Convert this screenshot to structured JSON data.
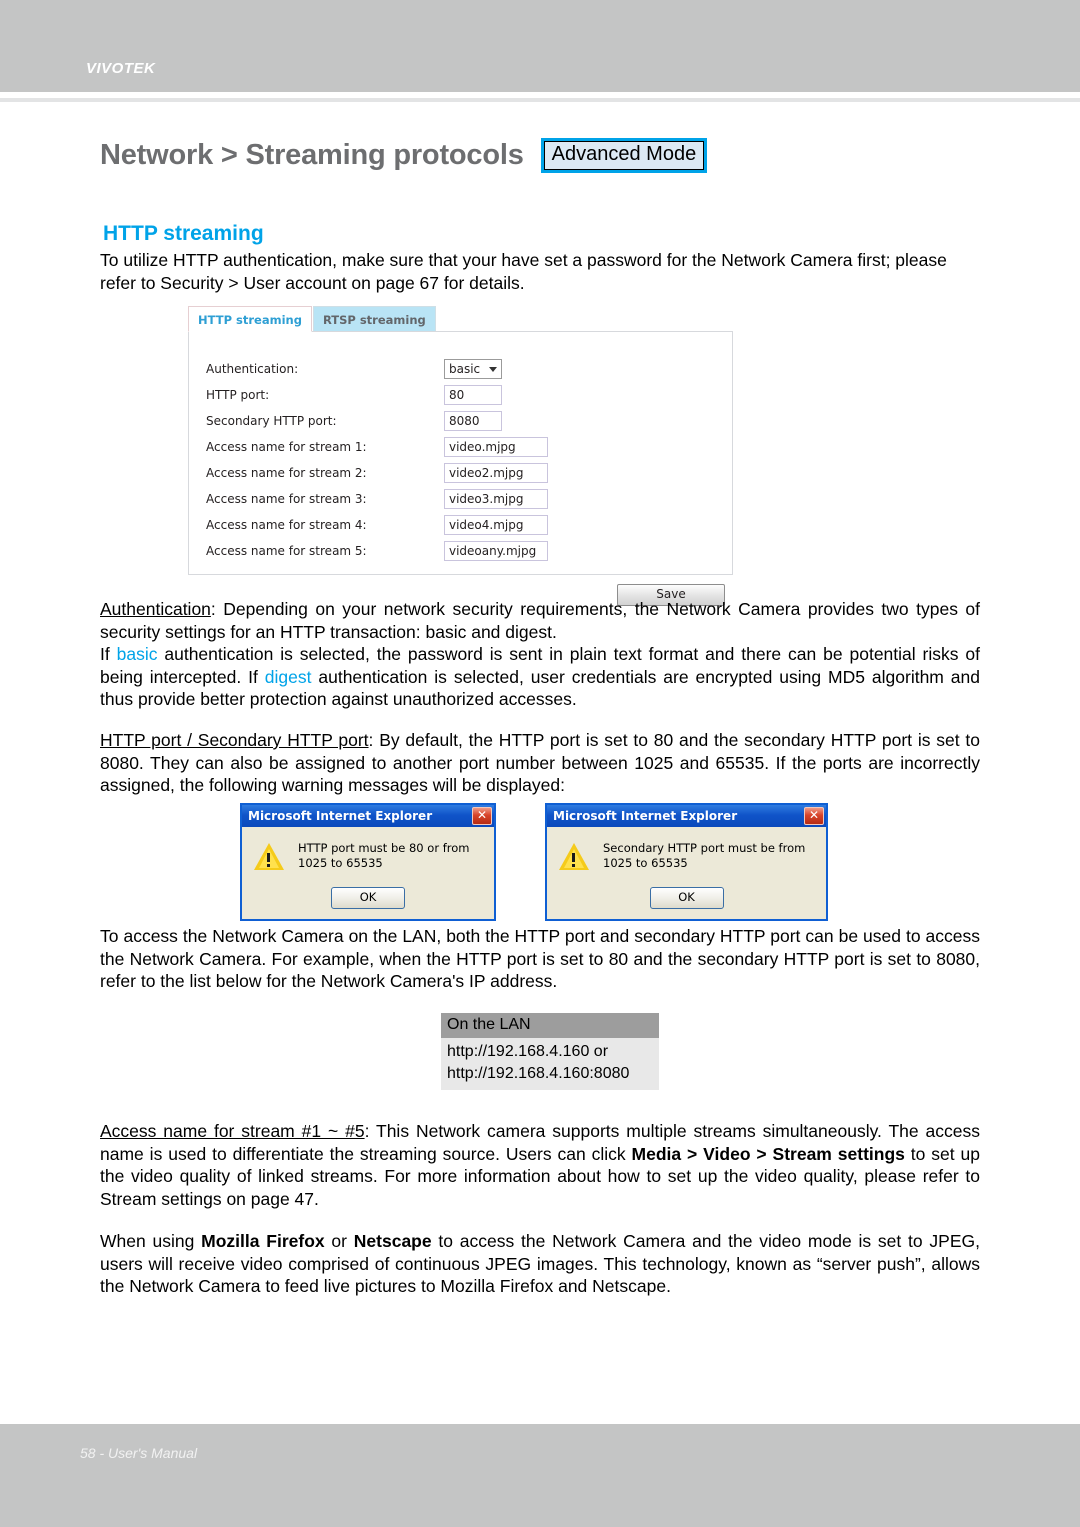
{
  "header": {
    "brand": "VIVOTEK"
  },
  "footer": {
    "text": "58 - User's Manual"
  },
  "title": {
    "heading": "Network > Streaming protocols",
    "badge": "Advanced Mode"
  },
  "section": {
    "title": "HTTP streaming",
    "intro": "To utilize HTTP authentication, make sure that your have set a password for the Network Camera first; please refer to Security > User account on page 67 for details."
  },
  "camera_ui": {
    "tabs": [
      {
        "label": "HTTP streaming",
        "active": true
      },
      {
        "label": "RTSP streaming",
        "active": false
      }
    ],
    "fields": [
      {
        "label": "Authentication:",
        "value": "basic",
        "type": "select"
      },
      {
        "label": "HTTP port:",
        "value": "80",
        "type": "port"
      },
      {
        "label": "Secondary HTTP port:",
        "value": "8080",
        "type": "port"
      },
      {
        "label": "Access name for stream 1:",
        "value": "video.mjpg",
        "type": "name"
      },
      {
        "label": "Access name for stream 2:",
        "value": "video2.mjpg",
        "type": "name"
      },
      {
        "label": "Access name for stream 3:",
        "value": "video3.mjpg",
        "type": "name"
      },
      {
        "label": "Access name for stream 4:",
        "value": "video4.mjpg",
        "type": "name"
      },
      {
        "label": "Access name for stream 5:",
        "value": "videoany.mjpg",
        "type": "name"
      }
    ],
    "save_label": "Save"
  },
  "paragraphs": {
    "authentication": {
      "term": "Authentication",
      "line1": ": Depending on your network security requirements, the Network Camera provides two types of security settings for an HTTP transaction: basic and digest.",
      "line2_a": "If ",
      "basic": "basic",
      "line2_b": " authentication is selected, the password is sent in plain text format and there can be potential risks of being intercepted. If ",
      "digest": "digest",
      "line2_c": " authentication is selected, user credentials are encrypted using MD5 algorithm and thus provide better protection against unauthorized accesses."
    },
    "http_port": {
      "term": "HTTP port / Secondary HTTP port",
      "body": ": By default, the HTTP port is set to 80 and the secondary HTTP port is set to 8080. They can also be assigned to another port number between 1025 and 65535. If the ports are incorrectly assigned, the following warning messages will be displayed:"
    },
    "lan_access": "To access the Network Camera on the LAN, both the HTTP port and secondary HTTP port can be used to access the Network Camera. For example, when the HTTP port is set to 80 and the secondary HTTP port is set to 8080, refer to the list below for the Network Camera's IP address.",
    "access_name": {
      "term": "Access name for stream #1 ~ #5",
      "part1": ": This Network camera supports multiple streams simultaneously. The access name is used to differentiate the streaming source. Users can click ",
      "bold1": "Media > Video > Stream settings",
      "part2": " to set up the video quality of linked streams. For more information about how to set up the video quality, please refer to Stream settings on page 47."
    },
    "browsers": {
      "part1": "When using ",
      "bold1": "Mozilla Firefox",
      "part2": " or ",
      "bold2": "Netscape",
      "part3": " to access the Network Camera and the video mode is set to JPEG, users will receive video comprised of continuous JPEG images. This technology, known as “server push”, allows the Network Camera to feed live pictures to Mozilla Firefox and Netscape."
    }
  },
  "dialogs": [
    {
      "title": "Microsoft Internet Explorer",
      "message": "HTTP port must be 80 or from 1025 to 65535",
      "ok_label": "OK",
      "close_label": "✕"
    },
    {
      "title": "Microsoft Internet Explorer",
      "message": "Secondary HTTP port must be from 1025 to 65535",
      "ok_label": "OK",
      "close_label": "✕"
    }
  ],
  "lan_table": {
    "header": "On the LAN",
    "line1": "http://192.168.4.160  or",
    "line2": "http://192.168.4.160:8080"
  },
  "colors": {
    "accent_blue": "#00a3e8",
    "header_gray": "#c4c5c5",
    "title_gray": "#6d6e70"
  }
}
